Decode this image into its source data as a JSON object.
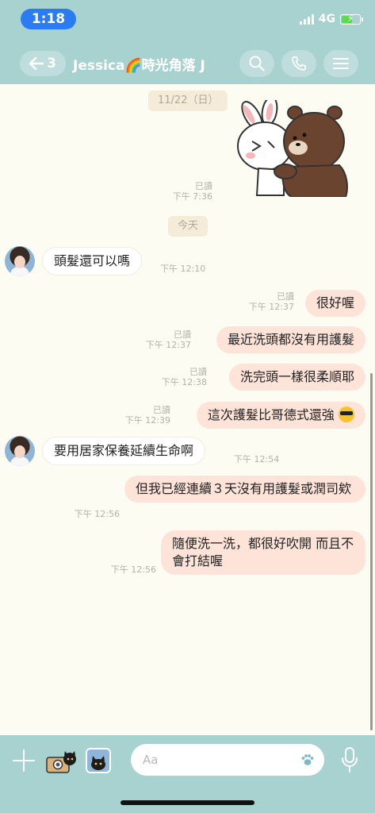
{
  "status": {
    "time": "1:18",
    "network": "4G"
  },
  "header": {
    "back_count": "3",
    "title": "Jessica🌈時光角落 J"
  },
  "chat": {
    "date1": "11/22（日）",
    "sticker_meta": {
      "read": "已讀",
      "time": "下午 7:36"
    },
    "date2": "今天",
    "messages": [
      {
        "side": "in",
        "text": "頭髮還可以嗎",
        "time": "下午 12:10"
      },
      {
        "side": "out",
        "text": "很好喔",
        "read": "已讀",
        "time": "下午 12:37"
      },
      {
        "side": "out",
        "text": "最近洗頭都沒有用護髮",
        "read": "已讀",
        "time": "下午 12:37"
      },
      {
        "side": "out",
        "text": "洗完頭一樣很柔順耶",
        "read": "已讀",
        "time": "下午 12:38"
      },
      {
        "side": "out",
        "text": "這次護髮比哥德式還強",
        "read": "已讀",
        "time": "下午 12:39"
      },
      {
        "side": "in",
        "text": "要用居家保養延續生命啊",
        "time": "下午 12:54"
      },
      {
        "side": "out",
        "text": "但我已經連續３天沒有用護髮或潤司欸",
        "time": "下午 12:56"
      },
      {
        "side": "out",
        "text": "隨便洗一洗，都很好吹開 而且不會打結喔",
        "time": "下午 12:56"
      }
    ]
  },
  "input": {
    "placeholder": "Aa"
  },
  "icons": {
    "back": "arrow-left-icon",
    "search": "search-icon",
    "call": "phone-icon",
    "menu": "menu-icon",
    "plus": "plus-icon",
    "camera": "camera-icon",
    "gallery": "gallery-icon",
    "paw": "paw-icon",
    "mic": "mic-icon"
  },
  "colors": {
    "header": "#a8d2d0",
    "outgoing": "#fde3d8",
    "incoming": "#ffffff",
    "background": "#fdfcf3"
  }
}
